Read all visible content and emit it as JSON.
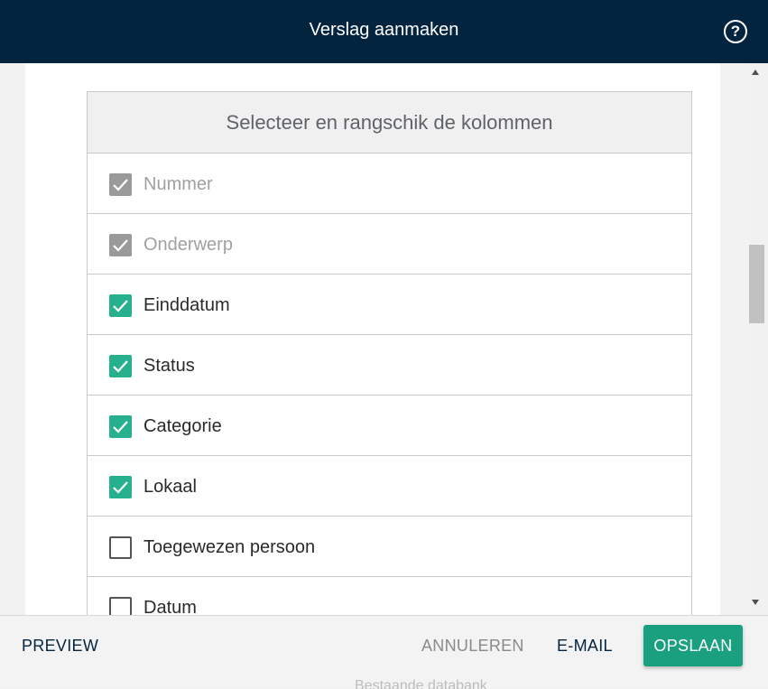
{
  "header": {
    "title": "Verslag aanmaken",
    "help_icon": "help-circle-icon"
  },
  "table": {
    "title": "Selecteer en rangschik de kolommen",
    "rows": [
      {
        "label": "Nummer",
        "state": "disabled-checked"
      },
      {
        "label": "Onderwerp",
        "state": "disabled-checked"
      },
      {
        "label": "Einddatum",
        "state": "checked"
      },
      {
        "label": "Status",
        "state": "checked"
      },
      {
        "label": "Categorie",
        "state": "checked"
      },
      {
        "label": "Lokaal",
        "state": "checked"
      },
      {
        "label": "Toegewezen persoon",
        "state": "unchecked"
      },
      {
        "label": "Datum",
        "state": "unchecked"
      }
    ]
  },
  "footer": {
    "preview": "PREVIEW",
    "cancel": "ANNULEREN",
    "email": "E-MAIL",
    "save": "OPSLAAN",
    "behind_text": "Bestaande databank"
  },
  "colors": {
    "header_bg": "#03243f",
    "accent": "#1ba07f",
    "checkbox_checked": "#27b08e",
    "checkbox_disabled": "#9a9a9a"
  }
}
